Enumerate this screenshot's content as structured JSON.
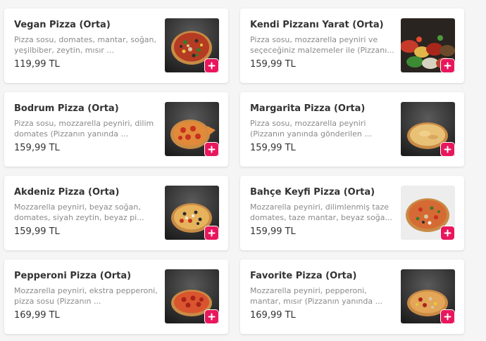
{
  "currency": "TL",
  "products": [
    {
      "name": "Vegan Pizza (Orta)",
      "description": "Pizza sosu, domates, mantar, soğan, yeşilbiber, zeytin, mısır ...",
      "price": "119,99 TL",
      "image": "vegan-pizza"
    },
    {
      "name": "Kendi Pizzanı Yarat (Orta)",
      "description": "Pizza sosu, mozzarella peyniri ve seçeceğiniz malzemeler ile (Pizzanı...",
      "price": "159,99 TL",
      "image": "ingredients-spread"
    },
    {
      "name": "Bodrum Pizza (Orta)",
      "description": "Pizza sosu, mozzarella peyniri, dilim domates (Pizzanın yanında ...",
      "price": "159,99 TL",
      "image": "bodrum-pizza"
    },
    {
      "name": "Margarita Pizza (Orta)",
      "description": "Pizza sosu, mozzarella peyniri (Pizzanın yanında gönderilen ...",
      "price": "159,99 TL",
      "image": "margarita-pizza"
    },
    {
      "name": "Akdeniz Pizza (Orta)",
      "description": "Mozzarella peyniri, beyaz soğan, domates, siyah zeytin, beyaz pi...",
      "price": "159,99 TL",
      "image": "akdeniz-pizza"
    },
    {
      "name": "Bahçe Keyfi Pizza (Orta)",
      "description": "Mozzarella peyniri, dilimlenmiş taze domates, taze mantar, beyaz soğa...",
      "price": "159,99 TL",
      "image": "bahce-keyfi-pizza"
    },
    {
      "name": "Pepperoni Pizza (Orta)",
      "description": "Mozzarella peyniri, ekstra pepperoni, pizza sosu (Pizzanın ...",
      "price": "169,99 TL",
      "image": "pepperoni-pizza"
    },
    {
      "name": "Favorite Pizza (Orta)",
      "description": "Mozzarella peyniri, pepperoni, mantar, mısır (Pizzanın yanında ...",
      "price": "169,99 TL",
      "image": "favorite-pizza"
    }
  ],
  "colors": {
    "accent": "#e8175d",
    "background": "#f5f5f5",
    "card": "#ffffff",
    "title": "#333333",
    "description": "#8a8a8a"
  },
  "icons": {
    "add": "plus-icon"
  }
}
